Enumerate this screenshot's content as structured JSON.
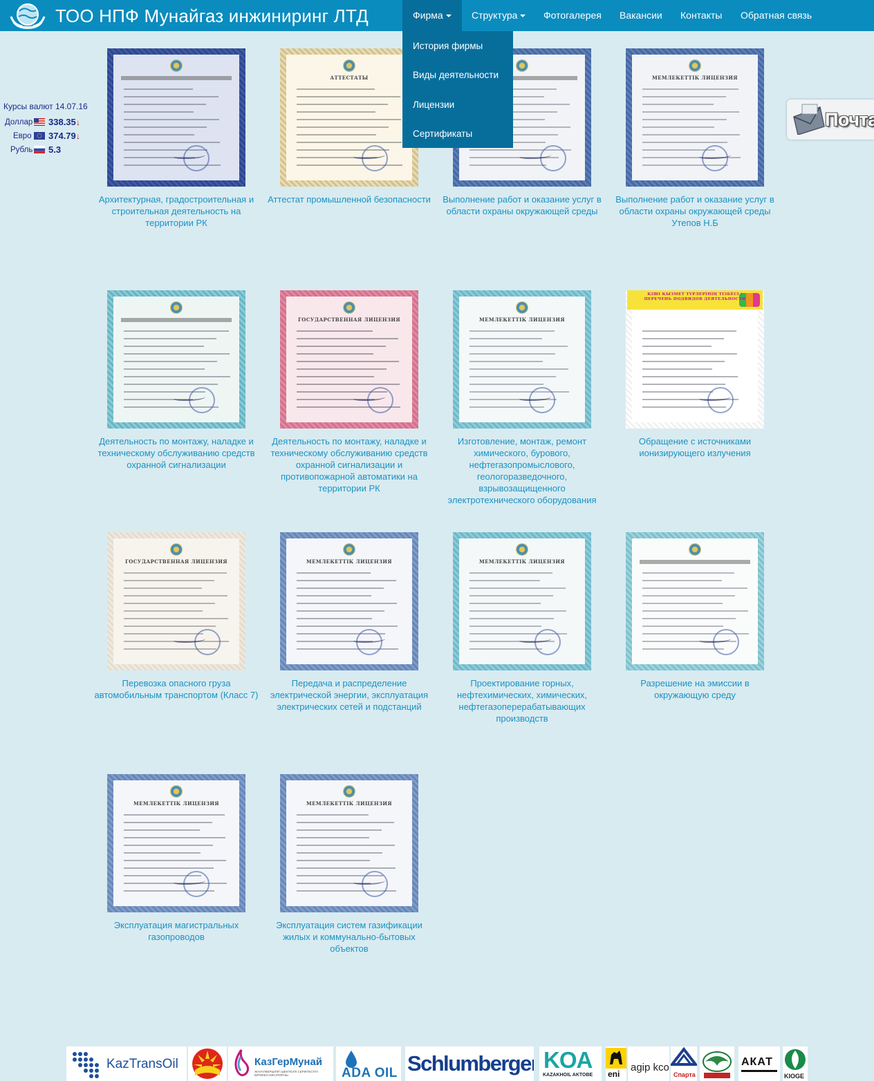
{
  "brand": {
    "title": "ТОО НПФ Мунайгаз инжиниринг ЛТД",
    "logo": "globe-hands-logo"
  },
  "nav": {
    "items": [
      {
        "label": "Фирма",
        "dropdown": true,
        "active": true
      },
      {
        "label": "Структура",
        "dropdown": true
      },
      {
        "label": "Фотогалерея"
      },
      {
        "label": "Вакансии"
      },
      {
        "label": "Контакты"
      },
      {
        "label": "Обратная связь"
      }
    ],
    "submenu": [
      "История фирмы",
      "Виды деятельности",
      "Лицензии",
      "Сертификаты"
    ]
  },
  "rates": {
    "title": "Курсы валют 14.07.16",
    "items": [
      {
        "name": "Доллар",
        "value": "338.35",
        "arrow": "↓"
      },
      {
        "name": "Евро",
        "value": "374.79",
        "arrow": "↓"
      },
      {
        "name": "Рубль",
        "value": "5.3",
        "arrow": ""
      }
    ]
  },
  "mail": {
    "label": "Почта"
  },
  "gallery": [
    {
      "caption": "Архитектурная, градостроительная и строительная деятельность на территории РК"
    },
    {
      "caption": "Аттестат промышленной безопасности",
      "doc_title": "АТТЕСТАТЫ"
    },
    {
      "caption": "Выполнение работ и оказание услуг в области охраны окружающей среды"
    },
    {
      "caption": "Выполнение работ и оказание услуг в области охраны окружающей среды Утепов Н.Б",
      "doc_title": "МЕМЛЕКЕТТІК ЛИЦЕНЗИЯ"
    },
    {
      "caption": "Деятельность по монтажу, наладке и техническому обслуживанию средств охранной сигнализации"
    },
    {
      "caption": "Деятельность по монтажу, наладке и техническому обслуживанию средств охранной сигнализации и противопожарной автоматики на территории РК",
      "doc_title": "ГОСУДАРСТВЕННАЯ ЛИЦЕНЗИЯ"
    },
    {
      "caption": "Изготовление, монтаж, ремонт химического, бурового, нефтегазопромыслового, геологоразведочного, взрывозащищенного электротехнического оборудования",
      "doc_title": "МЕМЛЕКЕТТІК ЛИЦЕНЗИЯ"
    },
    {
      "caption": "Обращение с источниками ионизирующего излучения",
      "doc_title": "ҚІШІ ҚЫЗМЕТ ТҮРЛЕРІНІҢ ТІЗБЕСІ / ПЕРЕЧЕНЬ ПОДВИДОВ ДЕЯТЕЛЬНОСТИ"
    },
    {
      "caption": "Перевозка опасного груза автомобильным транспортом (Класс 7)",
      "doc_title": "ГОСУДАРСТВЕННАЯ ЛИЦЕНЗИЯ"
    },
    {
      "caption": "Передача и распределение электрической энергии, эксплуатация электрических сетей и подстанций",
      "doc_title": "МЕМЛЕКЕТТІК ЛИЦЕНЗИЯ"
    },
    {
      "caption": "Проектирование горных, нефтехимических, химических, нефтегазоперерабатывающих производств",
      "doc_title": "МЕМЛЕКЕТТІК ЛИЦЕНЗИЯ"
    },
    {
      "caption": "Разрешение на эмиссии в окружающую среду"
    },
    {
      "caption": "Эксплуатация магистральных газопроводов",
      "doc_title": "МЕМЛЕКЕТТІК ЛИЦЕНЗИЯ"
    },
    {
      "caption": "Эксплуатация систем газификации жилых и коммунально-бытовых объектов",
      "doc_title": "МЕМЛЕКЕТТІК ЛИЦЕНЗИЯ"
    }
  ],
  "partners": [
    {
      "name": "KazTransOil"
    },
    {
      "name": "cnpc-logo"
    },
    {
      "name": "КазГерМунай",
      "sub": "ЖАУАПКЕРШІЛІГІ ШЕКТЕУЛІ СЕРІКТЕСТІГІ БІРІККЕН КӘСІПОРНЫ"
    },
    {
      "name": "ADA OIL"
    },
    {
      "name": "Schlumberger"
    },
    {
      "name": "KOA",
      "sub": "KAZAKHOIL AKTOBE"
    },
    {
      "name": "eni"
    },
    {
      "name": "agip kco"
    },
    {
      "name": "Спарта"
    },
    {
      "name": "eagle-logo"
    },
    {
      "name": "АКАТ"
    },
    {
      "name": "KIOGE"
    }
  ],
  "colors": {
    "navbar": "#0a8cbf",
    "nav_active": "#076e9c",
    "background": "#d8ebf1",
    "link": "#1b92c3"
  }
}
